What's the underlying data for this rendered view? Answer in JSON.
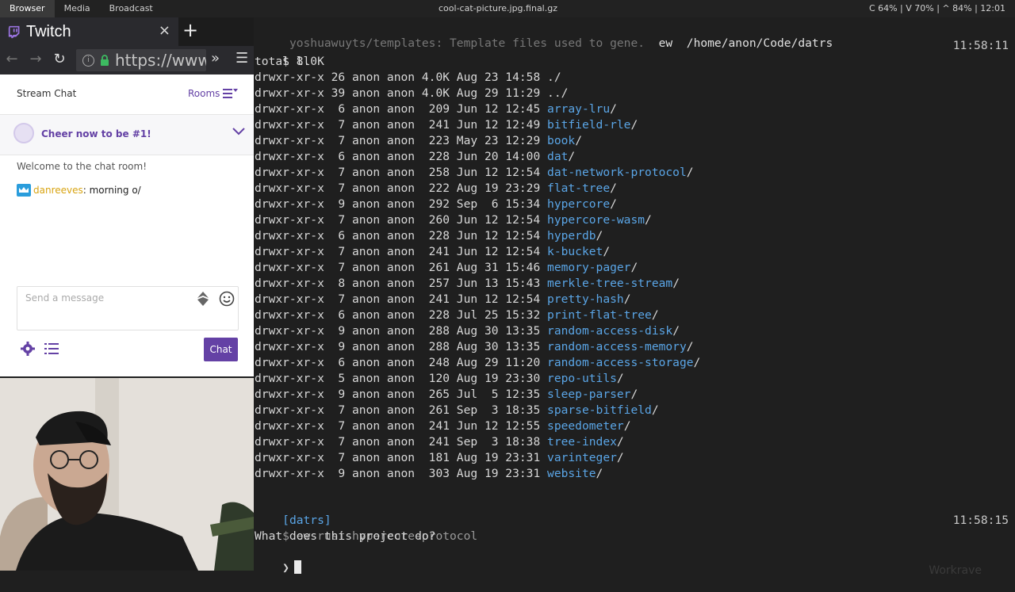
{
  "wm": {
    "tabs": [
      "Browser",
      "Media",
      "Broadcast"
    ],
    "title": "cool-cat-picture.jpg.final.gz",
    "status": "C 64% | V 70% | ^ 84% | 12:01"
  },
  "browser": {
    "tab_label": "Twitch",
    "close": "×",
    "new_tab": "+",
    "url": "https://www.twitch.tv",
    "nav": {
      "back": "←",
      "forward": "→",
      "reload": "↻",
      "more": "»",
      "menu": "☰"
    }
  },
  "chat": {
    "title": "Stream Chat",
    "rooms": "Rooms",
    "cheer": "Cheer now to be #1!",
    "welcome": "Welcome to the chat room!",
    "message_user": "danreeves",
    "message_text": ": morning o/",
    "placeholder": "Send a message",
    "send": "Chat"
  },
  "terminal": {
    "title_left": " yoshuawuyts/templates: Template files used to gene.",
    "title_mid": "ew",
    "title_path": "/home/anon/Code/datrs",
    "prompt1": "$ ll",
    "time1": "11:58:11",
    "total": "total 8.0K",
    "entries": [
      {
        "meta": "drwxr-xr-x 26 anon anon 4.0K Aug 23 14:58 ",
        "name": "./",
        "dir": false
      },
      {
        "meta": "drwxr-xr-x 39 anon anon 4.0K Aug 29 11:29 ",
        "name": "../",
        "dir": false
      },
      {
        "meta": "drwxr-xr-x  6 anon anon  209 Jun 12 12:45 ",
        "name": "array-lru",
        "dir": true
      },
      {
        "meta": "drwxr-xr-x  7 anon anon  241 Jun 12 12:49 ",
        "name": "bitfield-rle",
        "dir": true
      },
      {
        "meta": "drwxr-xr-x  7 anon anon  223 May 23 12:29 ",
        "name": "book",
        "dir": true
      },
      {
        "meta": "drwxr-xr-x  6 anon anon  228 Jun 20 14:00 ",
        "name": "dat",
        "dir": true
      },
      {
        "meta": "drwxr-xr-x  7 anon anon  258 Jun 12 12:54 ",
        "name": "dat-network-protocol",
        "dir": true
      },
      {
        "meta": "drwxr-xr-x  7 anon anon  222 Aug 19 23:29 ",
        "name": "flat-tree",
        "dir": true
      },
      {
        "meta": "drwxr-xr-x  9 anon anon  292 Sep  6 15:34 ",
        "name": "hypercore",
        "dir": true
      },
      {
        "meta": "drwxr-xr-x  7 anon anon  260 Jun 12 12:54 ",
        "name": "hypercore-wasm",
        "dir": true
      },
      {
        "meta": "drwxr-xr-x  6 anon anon  228 Jun 12 12:54 ",
        "name": "hyperdb",
        "dir": true
      },
      {
        "meta": "drwxr-xr-x  7 anon anon  241 Jun 12 12:54 ",
        "name": "k-bucket",
        "dir": true
      },
      {
        "meta": "drwxr-xr-x  7 anon anon  261 Aug 31 15:46 ",
        "name": "memory-pager",
        "dir": true
      },
      {
        "meta": "drwxr-xr-x  8 anon anon  257 Jun 13 15:43 ",
        "name": "merkle-tree-stream",
        "dir": true
      },
      {
        "meta": "drwxr-xr-x  7 anon anon  241 Jun 12 12:54 ",
        "name": "pretty-hash",
        "dir": true
      },
      {
        "meta": "drwxr-xr-x  6 anon anon  228 Jul 25 15:32 ",
        "name": "print-flat-tree",
        "dir": true
      },
      {
        "meta": "drwxr-xr-x  9 anon anon  288 Aug 30 13:35 ",
        "name": "random-access-disk",
        "dir": true
      },
      {
        "meta": "drwxr-xr-x  9 anon anon  288 Aug 30 13:35 ",
        "name": "random-access-memory",
        "dir": true
      },
      {
        "meta": "drwxr-xr-x  6 anon anon  248 Aug 29 11:20 ",
        "name": "random-access-storage",
        "dir": true
      },
      {
        "meta": "drwxr-xr-x  5 anon anon  120 Aug 19 23:30 ",
        "name": "repo-utils",
        "dir": true
      },
      {
        "meta": "drwxr-xr-x  9 anon anon  265 Jul  5 12:35 ",
        "name": "sleep-parser",
        "dir": true
      },
      {
        "meta": "drwxr-xr-x  7 anon anon  261 Sep  3 18:35 ",
        "name": "sparse-bitfield",
        "dir": true
      },
      {
        "meta": "drwxr-xr-x  7 anon anon  241 Jun 12 12:55 ",
        "name": "speedometer",
        "dir": true
      },
      {
        "meta": "drwxr-xr-x  7 anon anon  241 Sep  3 18:38 ",
        "name": "tree-index",
        "dir": true
      },
      {
        "meta": "drwxr-xr-x  7 anon anon  181 Aug 19 23:31 ",
        "name": "varinteger",
        "dir": true
      },
      {
        "meta": "drwxr-xr-x  9 anon anon  303 Aug 19 23:31 ",
        "name": "website",
        "dir": true
      }
    ],
    "dir_tag": "[datrs]",
    "prompt2": "$ ew rust hypercore-protocol",
    "time2": "11:58:15",
    "question": "What does this project do?",
    "input_prompt": "❯",
    "workrave": "Workrave"
  },
  "colors": {
    "twitch_purple": "#6441a5",
    "dir_blue": "#5aa5e6",
    "username_gold": "#d8a412"
  }
}
